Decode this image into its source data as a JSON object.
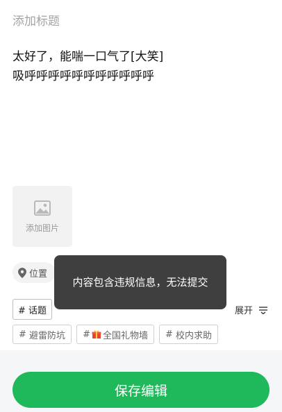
{
  "title_placeholder": "添加标题",
  "body": {
    "line1": "太好了，能喘一口气了[大笑]",
    "line2": "吸呼呼呼呼呼呼呼呼呼呼呼"
  },
  "add_image": {
    "label": "添加图片",
    "icon": "image-icon"
  },
  "location": {
    "label": "位置",
    "icon": "location-pin-icon"
  },
  "toast": {
    "message": "内容包含违规信息，无法提交"
  },
  "topic_button": {
    "label": "# 话题"
  },
  "expand": {
    "label": "展开",
    "icon": "filter-lines-icon"
  },
  "tags": [
    {
      "prefix": "#",
      "label": "避雷防坑",
      "icon": ""
    },
    {
      "prefix": "#",
      "label": "全国礼物墙",
      "icon": "gift-icon"
    },
    {
      "prefix": "#",
      "label": "校内求助",
      "icon": ""
    }
  ],
  "save_button": {
    "label": "保存编辑"
  },
  "colors": {
    "accent": "#1fb85b",
    "toast_bg": "#373737"
  }
}
